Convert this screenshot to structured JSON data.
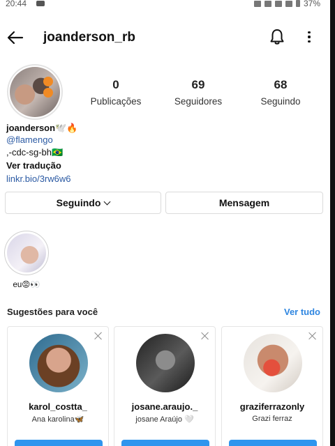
{
  "statusbar": {
    "time": "20:44",
    "battery": "37%"
  },
  "header": {
    "username": "joanderson_rb"
  },
  "stats": [
    {
      "value": "0",
      "label": "Publicações"
    },
    {
      "value": "69",
      "label": "Seguidores"
    },
    {
      "value": "68",
      "label": "Seguindo"
    }
  ],
  "bio": {
    "name": "joanderson🕊️🔥",
    "mention": "@flamengo",
    "line": ",-cdc-sg-bh🇧🇷",
    "translate": "Ver tradução",
    "link": "linkr.bio/3rw6w6"
  },
  "actions": {
    "following": "Seguindo",
    "message": "Mensagem"
  },
  "highlight": {
    "label": "eu😡👀"
  },
  "suggestions": {
    "title": "Sugestões para você",
    "see_all": "Ver tudo",
    "cards": [
      {
        "username": "karol_costta_",
        "name": "Ana karolina🦋"
      },
      {
        "username": "josane.araujo._",
        "name": "josane Araújo 🤍"
      },
      {
        "username": "graziferrazonly",
        "name": "Grazi ferraz"
      }
    ]
  }
}
